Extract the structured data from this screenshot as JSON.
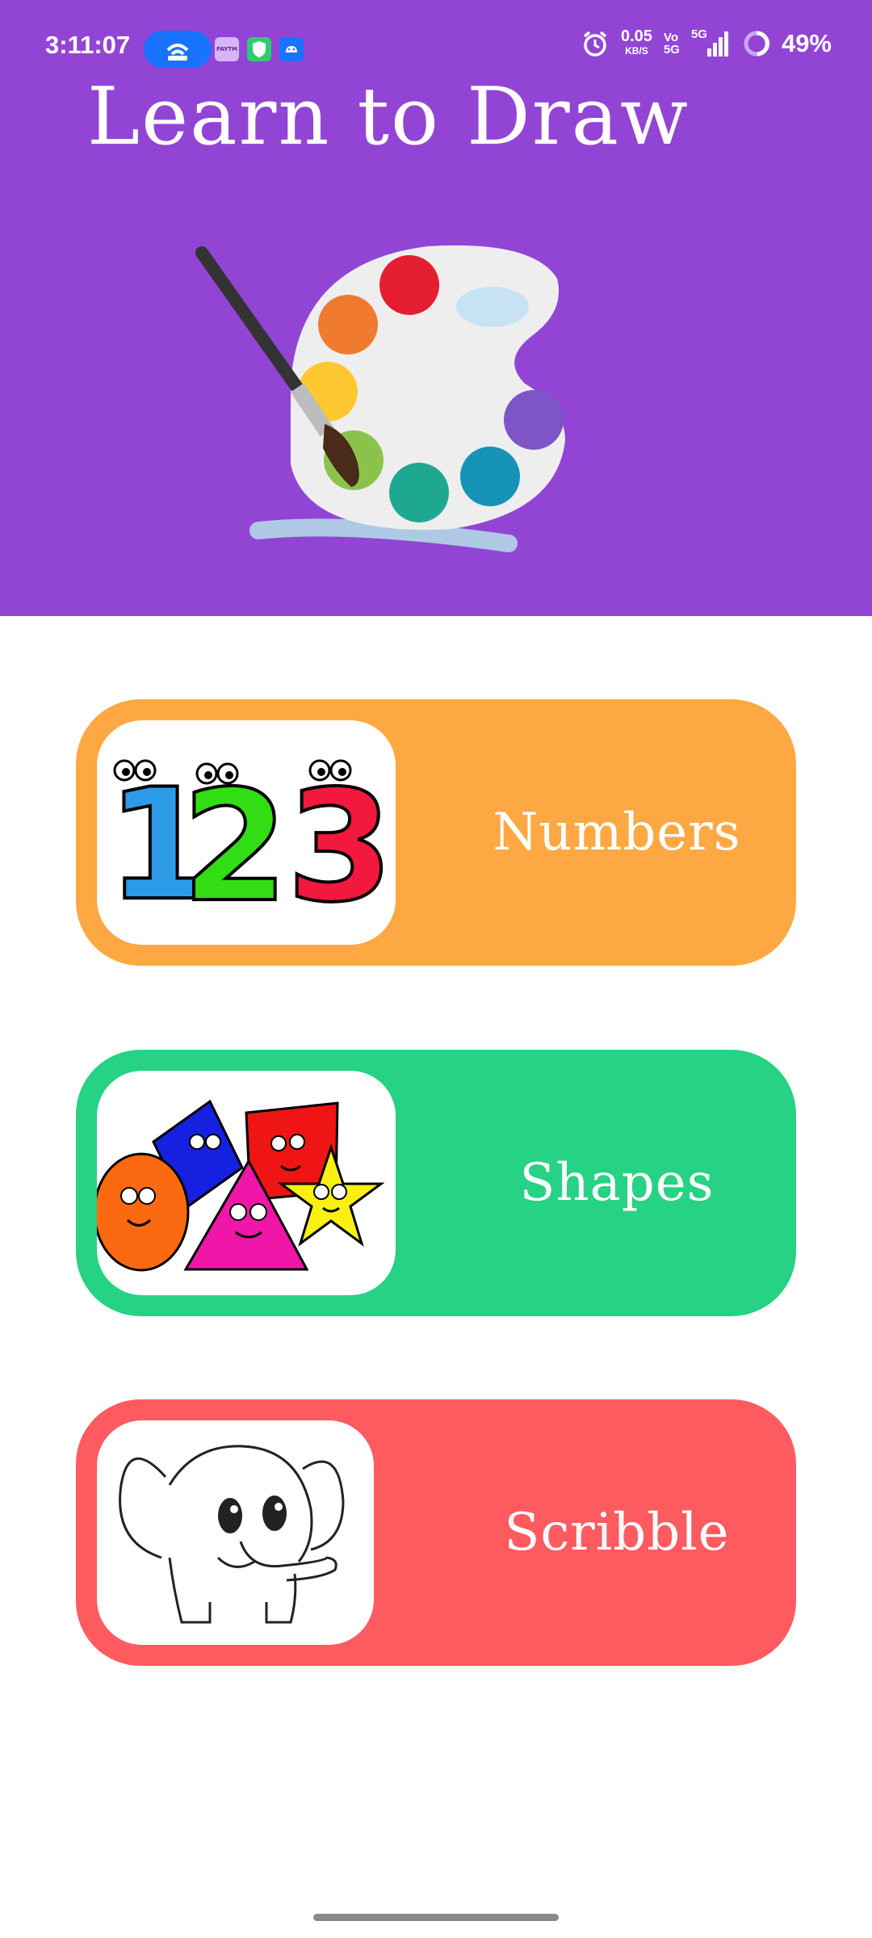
{
  "status_bar": {
    "time": "3:11:07",
    "paytm_label": "PAYTM",
    "net_speed": "0.05",
    "net_unit": "KB/S",
    "vo_label": "Vo",
    "vo_sub": "5G",
    "network": "5G",
    "battery": "49%"
  },
  "header": {
    "title": "Learn to Draw",
    "background_color": "#9245d5",
    "illustration": "paint-palette-icon"
  },
  "menu": [
    {
      "label": "Numbers",
      "color": "#fea843",
      "image": "numbers-123-icon"
    },
    {
      "label": "Shapes",
      "color": "#26d283",
      "image": "shapes-icon"
    },
    {
      "label": "Scribble",
      "color": "#fd5b60",
      "image": "elephant-icon"
    }
  ]
}
